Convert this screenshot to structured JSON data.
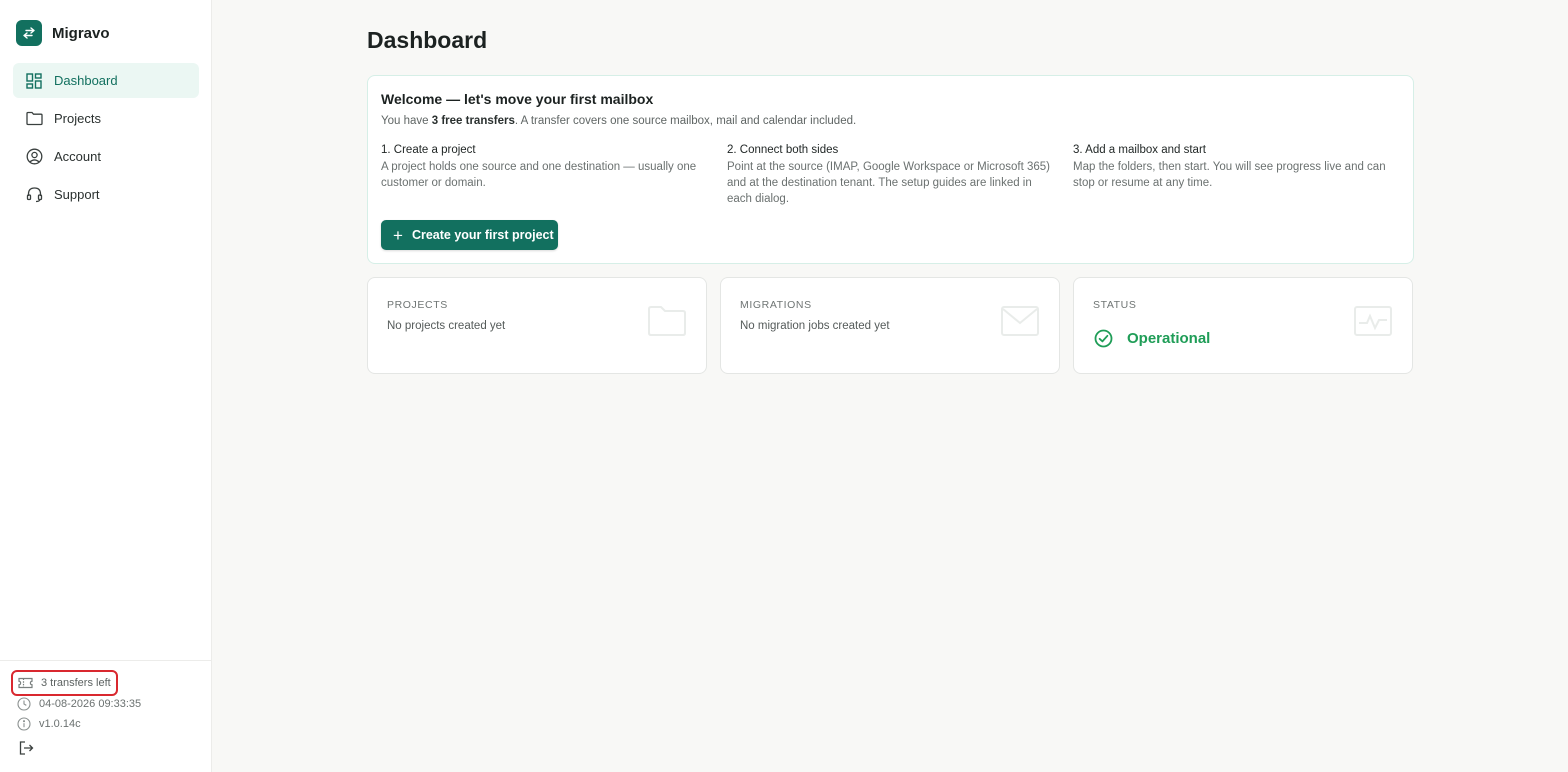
{
  "app": {
    "name": "Migravo"
  },
  "sidebar": {
    "items": [
      {
        "label": "Dashboard",
        "icon": "dashboard-icon",
        "active": true
      },
      {
        "label": "Projects",
        "icon": "folder-icon",
        "active": false
      },
      {
        "label": "Account",
        "icon": "user-circle-icon",
        "active": false
      },
      {
        "label": "Support",
        "icon": "headset-icon",
        "active": false
      }
    ],
    "footer": {
      "credits": "3 transfers left",
      "datetime": "04-08-2026 09:33:35",
      "version": "v1.0.14c"
    }
  },
  "page": {
    "title": "Dashboard"
  },
  "welcome": {
    "title": "Welcome — let's move your first mailbox",
    "sub_prefix": "You have ",
    "sub_bold": "3 free transfers",
    "sub_suffix": ". A transfer covers one source mailbox, mail and calendar included.",
    "steps": [
      {
        "title": "1. Create a project",
        "desc": "A project holds one source and one destination — usually one customer or domain."
      },
      {
        "title": "2. Connect both sides",
        "desc": "Point at the source (IMAP, Google Workspace or Microsoft 365) and at the destination tenant. The setup guides are linked in each dialog."
      },
      {
        "title": "3. Add a mailbox and start",
        "desc": "Map the folders, then start. You will see progress live and can stop or resume at any time."
      }
    ],
    "cta_label": "Create your first project"
  },
  "cards": {
    "projects": {
      "title": "PROJECTS",
      "value": "No projects created yet"
    },
    "migrations": {
      "title": "MIGRATIONS",
      "value": "No migration jobs created yet"
    },
    "status": {
      "title": "STATUS",
      "value": "Operational"
    }
  },
  "colors": {
    "brand": "#12705f",
    "active_bg": "#ebf7f3",
    "status_ok": "#1f9d57",
    "highlight": "#d9282f"
  }
}
